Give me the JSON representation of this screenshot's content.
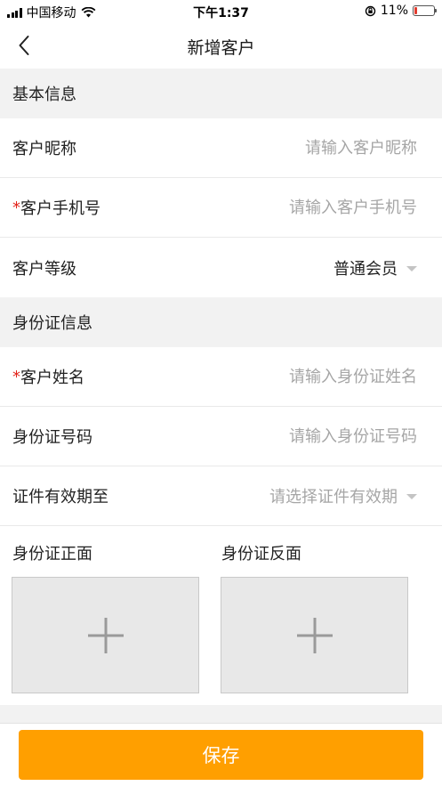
{
  "status_bar": {
    "carrier": "中国移动",
    "time": "下午1:37",
    "battery": "11%"
  },
  "nav": {
    "title": "新增客户"
  },
  "basic_info": {
    "header": "基本信息",
    "nickname": {
      "label": "客户昵称",
      "placeholder": "请输入客户昵称",
      "value": ""
    },
    "phone": {
      "required_mark": "*",
      "label": "客户手机号",
      "placeholder": "请输入客户手机号",
      "value": ""
    },
    "level": {
      "label": "客户等级",
      "value": "普通会员"
    }
  },
  "id_info": {
    "header": "身份证信息",
    "name": {
      "required_mark": "*",
      "label": "客户姓名",
      "placeholder": "请输入身份证姓名",
      "value": ""
    },
    "number": {
      "label": "身份证号码",
      "placeholder": "请输入身份证号码",
      "value": ""
    },
    "expiry": {
      "label": "证件有效期至",
      "placeholder": "请选择证件有效期"
    },
    "front": {
      "label": "身份证正面"
    },
    "back": {
      "label": "身份证反面"
    }
  },
  "footer": {
    "save_label": "保存"
  },
  "colors": {
    "accent": "#ff9f00",
    "required": "#e2231a",
    "section_bg": "#f2f2f2",
    "placeholder": "#a6a6a6"
  },
  "icons": {
    "back": "chevron-left-icon",
    "dropdown": "caret-down-icon",
    "upload": "plus-icon"
  }
}
